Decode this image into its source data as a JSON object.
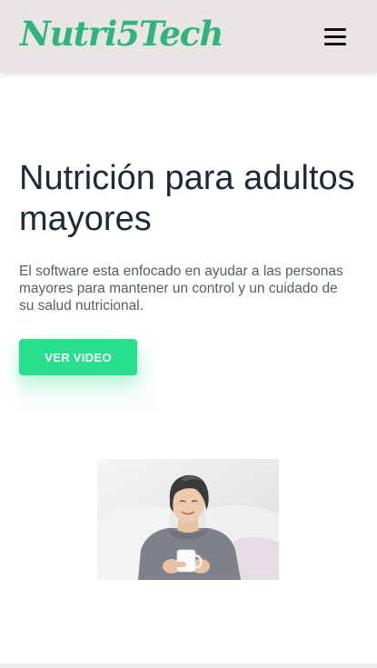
{
  "header": {
    "logo_text": "Nutri5Tech",
    "brand_color": "#2fb47c",
    "menu_icon": "hamburger-menu-icon"
  },
  "hero": {
    "title": "Nutrición para adultos mayores",
    "description": "El software esta enfocado en ayudar a las personas mayores para mantener un control y un cuidado de su salud nutricional.",
    "cta_label": "VER VIDEO",
    "cta_color": "#26e08d"
  },
  "media": {
    "image_subject": "elderly-woman-holding-cup"
  }
}
